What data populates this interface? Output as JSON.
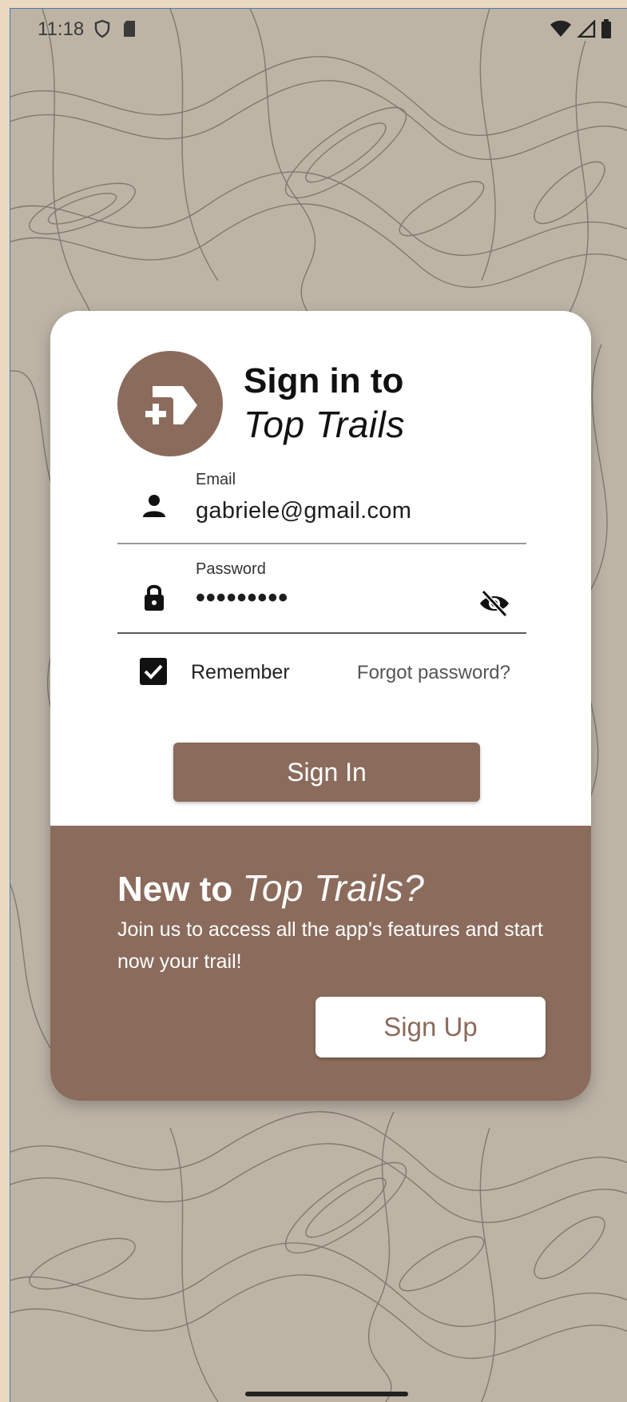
{
  "status_bar": {
    "time": "11:18",
    "icons_left": [
      "shield-icon",
      "sd-card-icon"
    ],
    "icons_right": [
      "wifi-icon",
      "signal-icon",
      "battery-icon"
    ]
  },
  "signin": {
    "title_line1": "Sign in to",
    "title_line2": "Top Trails",
    "email": {
      "label": "Email",
      "value": "gabriele@gmail.com",
      "icon": "person-icon"
    },
    "password": {
      "label": "Password",
      "value": "•••••••••",
      "icon": "lock-icon",
      "toggle_icon": "eye-off-icon"
    },
    "remember_label": "Remember",
    "remember_checked": true,
    "forgot_label": "Forgot password?",
    "button_label": "Sign In"
  },
  "signup": {
    "heading_bold": "New to ",
    "heading_italic": "Top Trails?",
    "text": "Join us to access all the app's features and start now your trail!",
    "button_label": "Sign Up"
  },
  "colors": {
    "brand": "#8b6b5c",
    "background": "#bdb4a6",
    "card": "#ffffff"
  }
}
